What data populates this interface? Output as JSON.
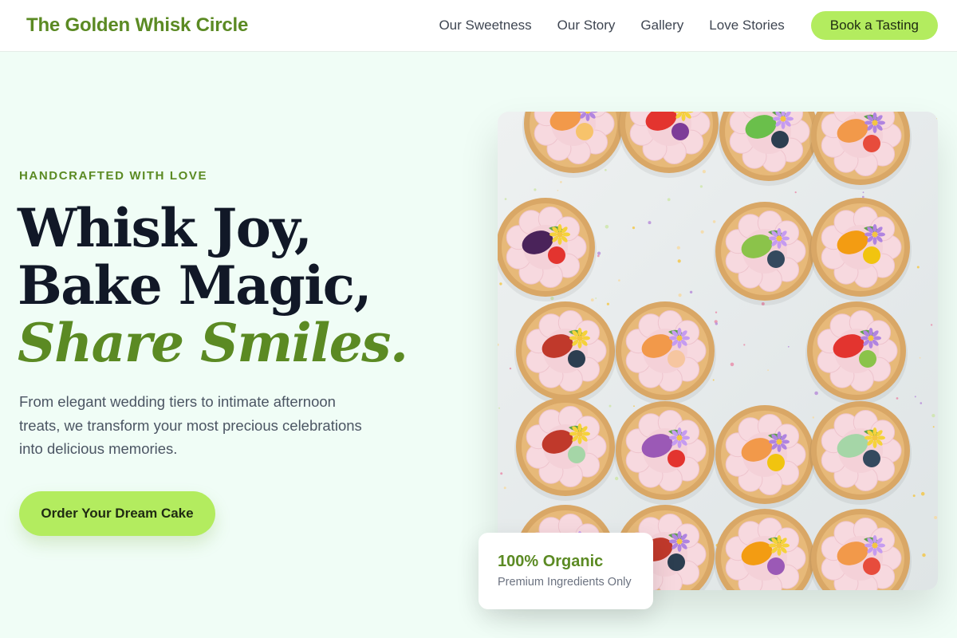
{
  "nav": {
    "brand": "The Golden Whisk Circle",
    "links": [
      "Our Sweetness",
      "Our Story",
      "Gallery",
      "Love Stories"
    ],
    "cta": "Book a Tasting"
  },
  "hero": {
    "eyebrow": "HANDCRAFTED WITH LOVE",
    "headline_part1": "Whisk Joy, Bake Magic, ",
    "headline_accent": "Share Smiles.",
    "lede": "From elegant wedding tiers to intimate afternoon treats, we transform your most precious celebrations into delicious memories.",
    "cta": "Order Your Dream Cake",
    "image_alt": "Fruit-topped tartlets with cream and edible flowers"
  },
  "badge": {
    "title": "100% Organic",
    "subtitle": "Premium Ingredients Only"
  },
  "colors": {
    "brand_green": "#5b8a23",
    "lime": "#b3ec5f",
    "page_bg": "#f0fdf6"
  }
}
